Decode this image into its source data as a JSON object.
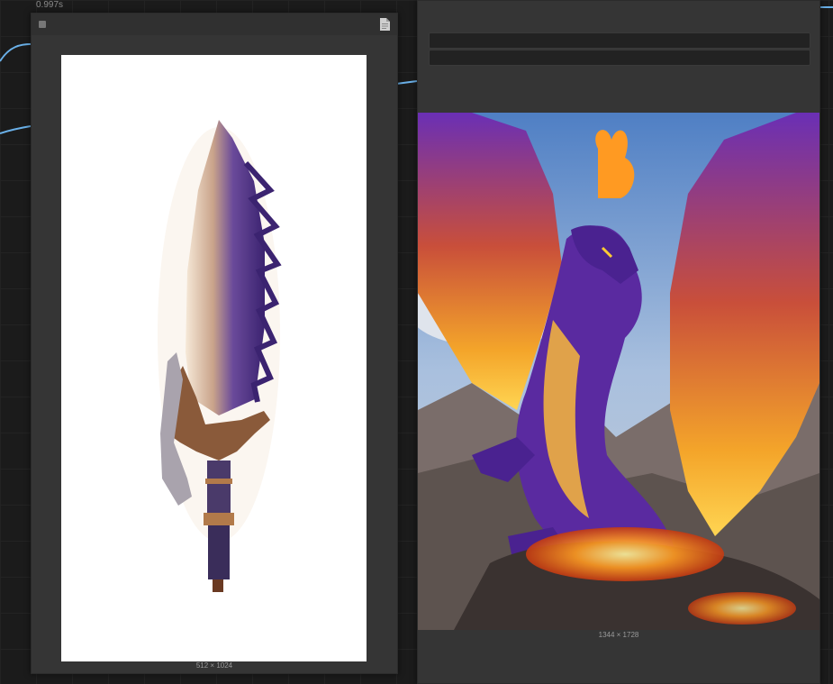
{
  "run_time": "0.997s",
  "left_node": {
    "size_label": "512 × 1024",
    "image_subject": "pixel-art sword with purple crystal blade"
  },
  "right_node": {
    "size_label": "1344 × 1728",
    "image_subject": "pixel-art purple dragon with fiery wings"
  },
  "colors": {
    "canvas": "#1b1b1b",
    "node_body": "#353535",
    "wire": "#6ab0e8",
    "port_blue": "#5aa8f0",
    "port_green": "#7fc97f"
  }
}
